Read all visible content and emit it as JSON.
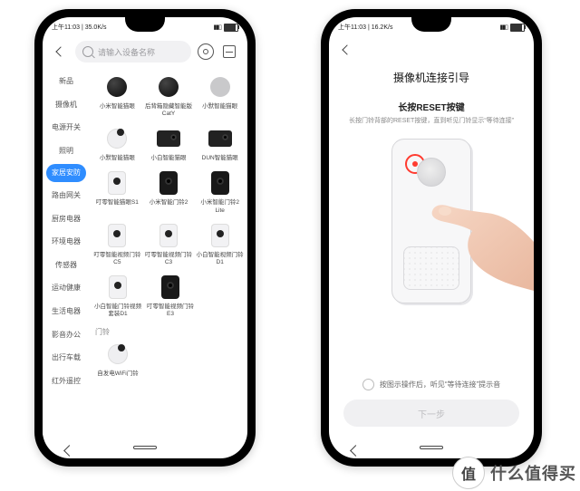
{
  "status": {
    "left": "上午11:03 | 35.0K/s",
    "left2": "上午11:03 | 16.2K/s",
    "battery_pct": 90
  },
  "left": {
    "search_placeholder": "请输入设备名称",
    "categories": [
      "新品",
      "摄像机",
      "电源开关",
      "照明",
      "家居安防",
      "路由网关",
      "厨房电器",
      "环境电器",
      "传感器",
      "运动健康",
      "生活电器",
      "影音办公",
      "出行车载",
      "红外遥控"
    ],
    "selected_index": 4,
    "rows": [
      [
        {
          "label": "小米智能猫眼",
          "shape": "circ-dark"
        },
        {
          "label": "后背箱隐藏智能版CatY",
          "shape": "circ-dark"
        },
        {
          "label": "小默智能猫眼",
          "shape": "circ-gray"
        }
      ],
      [
        {
          "label": "小默智能猫眼",
          "shape": "circ-wht"
        },
        {
          "label": "小白智能猫眼",
          "shape": "slab-dark"
        },
        {
          "label": "DUN智能猫眼",
          "shape": "slab-dark"
        }
      ],
      [
        {
          "label": "叮零智能猫眼S1",
          "shape": "rect-wht"
        },
        {
          "label": "小米智能门铃2",
          "shape": "rect-dark"
        },
        {
          "label": "小米智能门铃2 Lite",
          "shape": "rect-dark"
        }
      ],
      [
        {
          "label": "叮零智能视频门铃C5",
          "shape": "rect-wht"
        },
        {
          "label": "叮零智能视频门铃C3",
          "shape": "rect-wht"
        },
        {
          "label": "小白智能视频门铃D1",
          "shape": "rect-wht"
        }
      ],
      [
        {
          "label": "小白智能门铃视频套装D1",
          "shape": "rect-wht"
        },
        {
          "label": "叮零智能视频门铃E3",
          "shape": "rect-dark"
        }
      ]
    ],
    "section2_header": "门铃",
    "rows2": [
      [
        {
          "label": "自发电WiFi门铃",
          "shape": "circ-wht"
        }
      ]
    ]
  },
  "right": {
    "title": "摄像机连接引导",
    "subtitle": "长按RESET按键",
    "hint": "长按门铃背部的RESET按键，直到听见门铃显示“等待连接”",
    "check_label": "按图示操作后，听见“等待连接”提示音",
    "next_label": "下一步"
  },
  "watermark": {
    "badge": "值",
    "text": "什么值得买"
  }
}
